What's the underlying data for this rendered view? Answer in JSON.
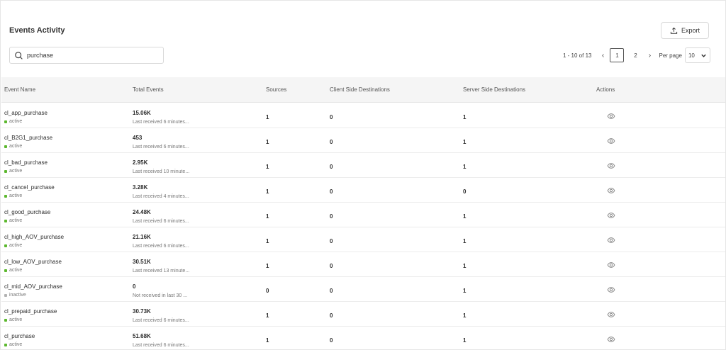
{
  "header": {
    "title": "Events Activity",
    "export_label": "Export"
  },
  "search": {
    "value": "purchase",
    "placeholder": ""
  },
  "pagination": {
    "range": "1 - 10 of 13",
    "prev": "‹",
    "next": "›",
    "pages": [
      "1",
      "2"
    ],
    "current_page": "1",
    "per_page_label": "Per page",
    "per_page_value": "10"
  },
  "columns": {
    "event_name": "Event Name",
    "total_events": "Total Events",
    "sources": "Sources",
    "client": "Client Side Destinations",
    "server": "Server Side Destinations",
    "actions": "Actions"
  },
  "colors": {
    "active": "#5cb82e",
    "inactive": "#b3b3b3"
  },
  "rows": [
    {
      "name": "cl_app_purchase",
      "status": "active",
      "total": "15.06K",
      "received": "Last received 6 minutes...",
      "sources": "1",
      "client": "0",
      "server": "1"
    },
    {
      "name": "cl_B2G1_purchase",
      "status": "active",
      "total": "453",
      "received": "Last received 6 minutes...",
      "sources": "1",
      "client": "0",
      "server": "1"
    },
    {
      "name": "cl_bad_purchase",
      "status": "active",
      "total": "2.95K",
      "received": "Last received 10 minute...",
      "sources": "1",
      "client": "0",
      "server": "1"
    },
    {
      "name": "cl_cancel_purchase",
      "status": "active",
      "total": "3.28K",
      "received": "Last received 4 minutes...",
      "sources": "1",
      "client": "0",
      "server": "0"
    },
    {
      "name": "cl_good_purchase",
      "status": "active",
      "total": "24.48K",
      "received": "Last received 6 minutes...",
      "sources": "1",
      "client": "0",
      "server": "1"
    },
    {
      "name": "cl_high_AOV_purchase",
      "status": "active",
      "total": "21.16K",
      "received": "Last received 6 minutes...",
      "sources": "1",
      "client": "0",
      "server": "1"
    },
    {
      "name": "cl_low_AOV_purchase",
      "status": "active",
      "total": "30.51K",
      "received": "Last received 13 minute...",
      "sources": "1",
      "client": "0",
      "server": "1"
    },
    {
      "name": "cl_mid_AOV_purchase",
      "status": "inactive",
      "total": "0",
      "received": "Not received in last 30 ...",
      "sources": "0",
      "client": "0",
      "server": "1"
    },
    {
      "name": "cl_prepaid_purchase",
      "status": "active",
      "total": "30.73K",
      "received": "Last received 6 minutes...",
      "sources": "1",
      "client": "0",
      "server": "1"
    },
    {
      "name": "cl_purchase",
      "status": "active",
      "total": "51.68K",
      "received": "Last received 6 minutes...",
      "sources": "1",
      "client": "0",
      "server": "1"
    }
  ]
}
